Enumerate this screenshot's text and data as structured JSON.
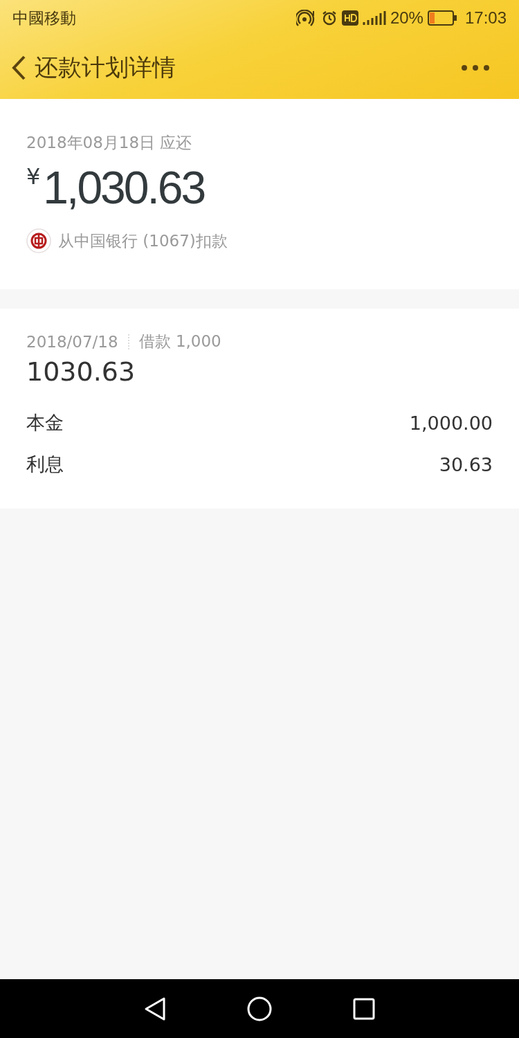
{
  "status_bar": {
    "carrier": "中國移動",
    "battery_text": "20%",
    "time": "17:03"
  },
  "header": {
    "title": "还款计划详情"
  },
  "due": {
    "date_label": "2018年08月18日 应还",
    "currency": "¥",
    "amount": "1,030.63",
    "bank_text": "从中国银行 (1067)扣款"
  },
  "plan": {
    "date": "2018/07/18",
    "loan": "借款 1,000",
    "total": "1030.63",
    "rows": [
      {
        "label": "本金",
        "value": "1,000.00"
      },
      {
        "label": "利息",
        "value": "30.63"
      }
    ]
  }
}
